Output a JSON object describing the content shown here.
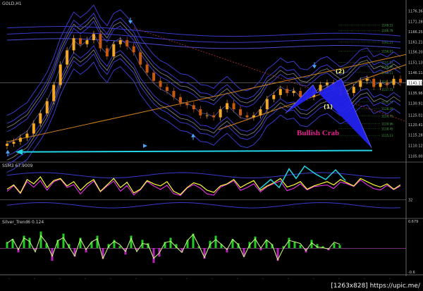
{
  "header": {
    "symbol_label": "GOLD,H1"
  },
  "panes": {
    "indicator1": {
      "label": "SSM3 67.9009",
      "level_label": "32"
    },
    "indicator2": {
      "label": "Silver_Trend6 0.124",
      "top_label": "0.679",
      "bottom_label": "-0.6"
    }
  },
  "annotations": {
    "pattern_name": "Bullish Crab",
    "point_2": "(2)",
    "point_1": "(1)",
    "watermark": "[1263x828] https://upic.me/"
  },
  "colors": {
    "background": "#000000",
    "price_up": "#f5a623",
    "price_down": "#c85a10",
    "band_blue": "#3a3acc",
    "band_gray": "#8a8a8a",
    "trendline_orange": "#d08020",
    "support_cyan": "#22d3e6",
    "pattern_blue": "#2222ee",
    "osc_yellow": "#ffff33",
    "osc_magenta": "#ff33ff",
    "hist_green": "#22cc22",
    "hist_magenta": "#bb22bb"
  },
  "chart_data": [
    {
      "type": "line",
      "title": "GOLD,H1",
      "ylim": [
        1102.7,
        1179.0
      ],
      "price_axis_ticks": [
        "1176.36",
        "1171.28",
        "1166.25",
        "1161.21",
        "1156.20",
        "1151.13",
        "1146.11",
        "1141.07",
        "1135.96",
        "1130.91",
        "1125.01",
        "1120.41",
        "1115.28",
        "1110.12",
        "1105.00"
      ],
      "price_axis_current": "1141.11",
      "fib_levels": [
        "1169.51",
        "1166.78",
        "1161.21",
        "1156.61",
        "1151.15",
        "1148.96",
        "1146.11",
        "1141.59",
        "1137.73",
        "1131.59",
        "1128.29",
        "1124.79",
        "1120.96",
        "1118.45",
        "1115.13"
      ],
      "close_series": [
        1111,
        1112,
        1114,
        1116,
        1121,
        1126,
        1132,
        1140,
        1150,
        1157,
        1163,
        1160,
        1162,
        1165,
        1158,
        1154,
        1160,
        1162,
        1159,
        1156,
        1150,
        1146,
        1142,
        1139,
        1137,
        1134,
        1131,
        1130,
        1128,
        1125,
        1125,
        1124,
        1128,
        1131,
        1128,
        1125,
        1124,
        1125,
        1128,
        1133,
        1135,
        1138,
        1136,
        1137,
        1134,
        1134,
        1137,
        1140,
        1141,
        1138,
        1135,
        1136,
        1139,
        1142,
        1143,
        1139,
        1141,
        1140,
        1143,
        1141
      ],
      "pattern": {
        "name": "Bullish Crab",
        "labels": [
          "(2)",
          "(1)"
        ]
      }
    },
    {
      "type": "line",
      "title": "SSM3 67.9009",
      "series": [
        {
          "values": [
            52,
            60,
            45,
            70,
            62,
            75,
            55,
            68,
            72,
            58,
            66,
            50,
            62,
            70,
            48,
            60,
            72,
            55,
            65,
            45,
            52,
            68,
            62,
            58,
            66,
            48,
            42,
            55,
            64,
            60,
            50,
            46,
            58,
            62,
            70,
            55,
            62,
            68,
            50,
            58,
            64,
            72,
            56,
            60,
            66,
            52,
            58,
            62,
            66,
            60,
            70,
            64,
            58,
            72,
            66,
            60,
            56,
            62,
            52,
            60
          ]
        }
      ]
    },
    {
      "type": "bar",
      "title": "Silver_Trend6 0.124",
      "ylim": [
        -0.6,
        0.679
      ],
      "values": [
        0.15,
        0.22,
        -0.1,
        0.3,
        0.25,
        -0.05,
        0.4,
        0.12,
        -0.3,
        0.2,
        0.35,
        0.1,
        -0.2,
        0.25,
        -0.1,
        0.15,
        0.3,
        -0.25,
        0.1,
        0.2,
        0.05,
        -0.15,
        0.3,
        -0.05,
        0.2,
        0.12,
        -0.35,
        -0.2,
        0.15,
        0.25,
        0.1,
        -0.1,
        0.2,
        0.35,
        0.05,
        -0.25,
        0.18,
        0.3,
        0.1,
        -0.1,
        0.22,
        0.12,
        -0.2,
        0.15,
        0.28,
        -0.05,
        0.2,
        0.1,
        -0.3,
        0.05,
        0.25,
        0.15,
        0.08,
        -0.1,
        0.2,
        0.1,
        0.05,
        -0.05,
        0.12,
        0.08
      ]
    }
  ]
}
